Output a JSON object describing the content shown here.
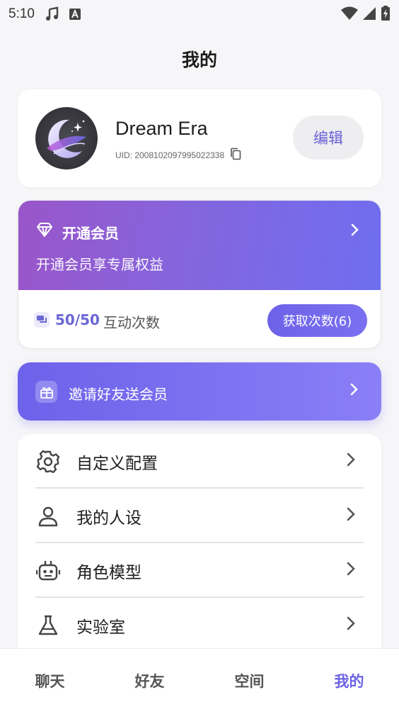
{
  "status_bar": {
    "time": "5:10",
    "icons": [
      "music-note-icon",
      "text-a-icon",
      "wifi-icon",
      "signal-icon",
      "battery-icon"
    ]
  },
  "header": {
    "title": "我的"
  },
  "profile": {
    "name": "Dream Era",
    "uid": "UID: 2008102097995022338",
    "edit_label": "编辑"
  },
  "membership": {
    "title": "开通会员",
    "subtitle": "开通会员享专属权益",
    "count": "50/50",
    "count_label": "互动次数",
    "get_button_label": "获取次数(6)"
  },
  "invite": {
    "label": "邀请好友送会员"
  },
  "menu": {
    "items": [
      {
        "label": "自定义配置",
        "icon": "gear-icon"
      },
      {
        "label": "我的人设",
        "icon": "person-icon"
      },
      {
        "label": "角色模型",
        "icon": "robot-icon"
      },
      {
        "label": "实验室",
        "icon": "flask-icon"
      }
    ]
  },
  "bottom_nav": {
    "tabs": [
      {
        "label": "聊天",
        "active": false
      },
      {
        "label": "好友",
        "active": false
      },
      {
        "label": "空间",
        "active": false
      },
      {
        "label": "我的",
        "active": true
      }
    ]
  },
  "colors": {
    "accent": "#6b62e6",
    "member_gradient_start": "#9a55c9",
    "member_gradient_end": "#6e6ef0",
    "background": "#f6f6f8"
  }
}
